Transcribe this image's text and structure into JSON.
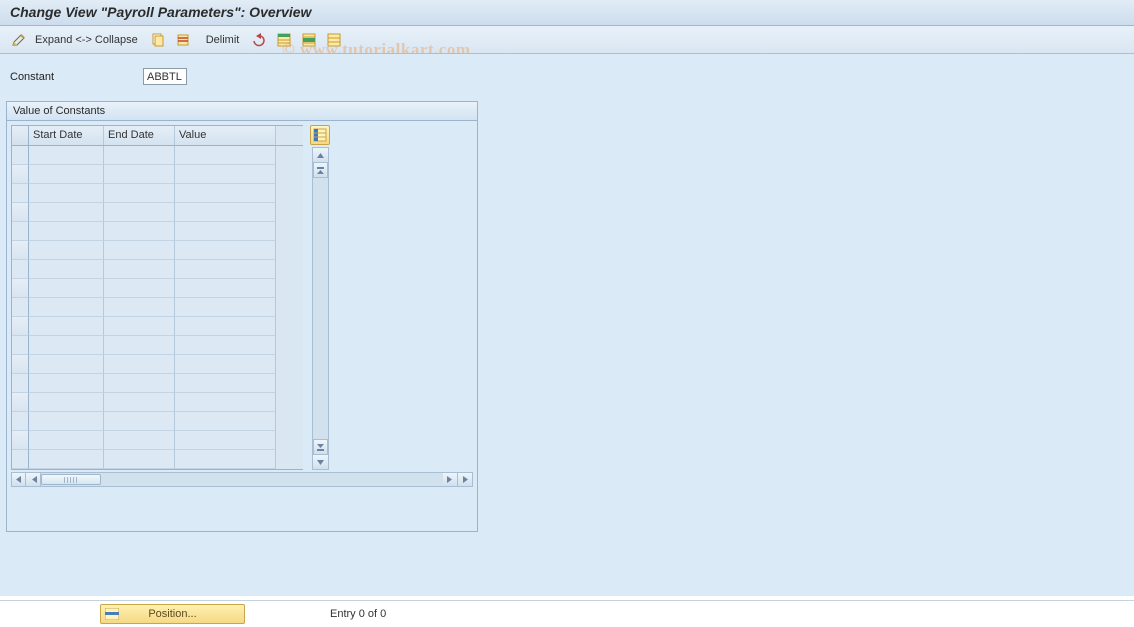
{
  "title": "Change View \"Payroll Parameters\": Overview",
  "watermark": "© www.tutorialkart.com",
  "toolbar": {
    "expand_collapse_label": "Expand <-> Collapse",
    "delimit_label": "Delimit"
  },
  "constant": {
    "label": "Constant",
    "value": "ABBTL"
  },
  "panel": {
    "title": "Value of Constants",
    "columns": [
      "Start Date",
      "End Date",
      "Value"
    ],
    "rows": [
      [
        "",
        "",
        ""
      ],
      [
        "",
        "",
        ""
      ],
      [
        "",
        "",
        ""
      ],
      [
        "",
        "",
        ""
      ],
      [
        "",
        "",
        ""
      ],
      [
        "",
        "",
        ""
      ],
      [
        "",
        "",
        ""
      ],
      [
        "",
        "",
        ""
      ],
      [
        "",
        "",
        ""
      ],
      [
        "",
        "",
        ""
      ],
      [
        "",
        "",
        ""
      ],
      [
        "",
        "",
        ""
      ],
      [
        "",
        "",
        ""
      ],
      [
        "",
        "",
        ""
      ],
      [
        "",
        "",
        ""
      ],
      [
        "",
        "",
        ""
      ],
      [
        "",
        "",
        ""
      ]
    ]
  },
  "footer": {
    "position_label": "Position...",
    "entry_text": "Entry 0 of 0"
  }
}
